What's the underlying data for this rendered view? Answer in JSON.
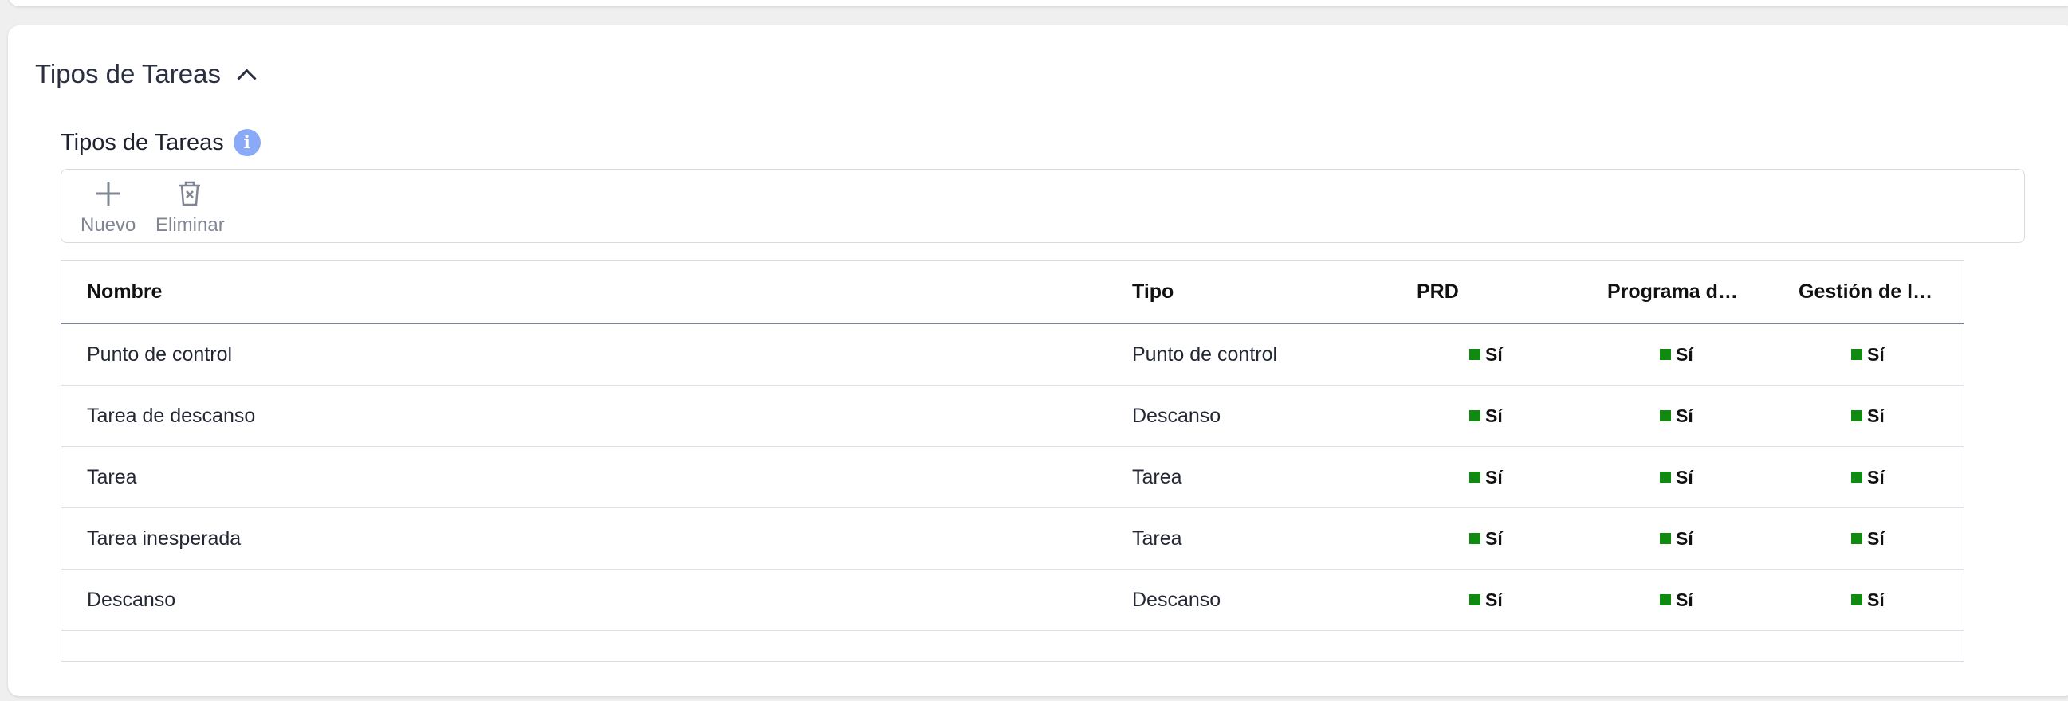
{
  "section": {
    "title": "Tipos de Tareas",
    "subtitle": "Tipos de Tareas"
  },
  "toolbar": {
    "new_label": "Nuevo",
    "delete_label": "Eliminar"
  },
  "table": {
    "columns": [
      "Nombre",
      "Tipo",
      "PRD",
      "Programa d…",
      "Gestión de l…"
    ],
    "rows": [
      {
        "nombre": "Punto de control",
        "tipo": "Punto de control",
        "prd": "Sí",
        "programa": "Sí",
        "gestion": "Sí"
      },
      {
        "nombre": "Tarea de descanso",
        "tipo": "Descanso",
        "prd": "Sí",
        "programa": "Sí",
        "gestion": "Sí"
      },
      {
        "nombre": "Tarea",
        "tipo": "Tarea",
        "prd": "Sí",
        "programa": "Sí",
        "gestion": "Sí"
      },
      {
        "nombre": "Tarea inesperada",
        "tipo": "Tarea",
        "prd": "Sí",
        "programa": "Sí",
        "gestion": "Sí"
      },
      {
        "nombre": "Descanso",
        "tipo": "Descanso",
        "prd": "Sí",
        "programa": "Sí",
        "gestion": "Sí"
      }
    ]
  },
  "colors": {
    "yes_indicator": "#118a12",
    "info_icon": "#8aa9f6"
  }
}
